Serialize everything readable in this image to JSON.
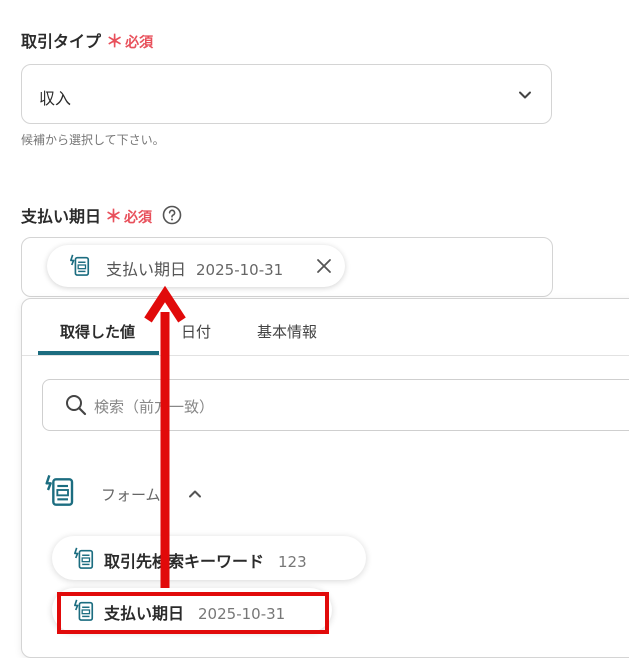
{
  "fields": {
    "transaction_type": {
      "label": "取引タイプ",
      "required_mark": "＊",
      "required_text": "必須",
      "value": "収入",
      "hint": "候補から選択して下さい。"
    },
    "payment_due_date": {
      "label": "支払い期日",
      "required_mark": "＊",
      "required_text": "必須",
      "chip_label": "支払い期日",
      "chip_value": "2025-10-31"
    }
  },
  "panel": {
    "tabs": [
      {
        "label": "取得した値",
        "active": true
      },
      {
        "label": "日付",
        "active": false
      },
      {
        "label": "基本情報",
        "active": false
      }
    ],
    "search_placeholder": "検索（前方一致）",
    "section_title": "フォーム",
    "items": [
      {
        "label": "取引先検索キーワード",
        "value": "123"
      },
      {
        "label": "支払い期日",
        "value": "2025-10-31"
      }
    ]
  },
  "colors": {
    "required": "#e8505b",
    "accent": "#1c6d80",
    "annotation": "#e10a0a"
  },
  "icons": [
    "chevron-down-icon",
    "help-icon",
    "form-icon",
    "close-icon",
    "search-icon",
    "chevron-up-icon"
  ]
}
